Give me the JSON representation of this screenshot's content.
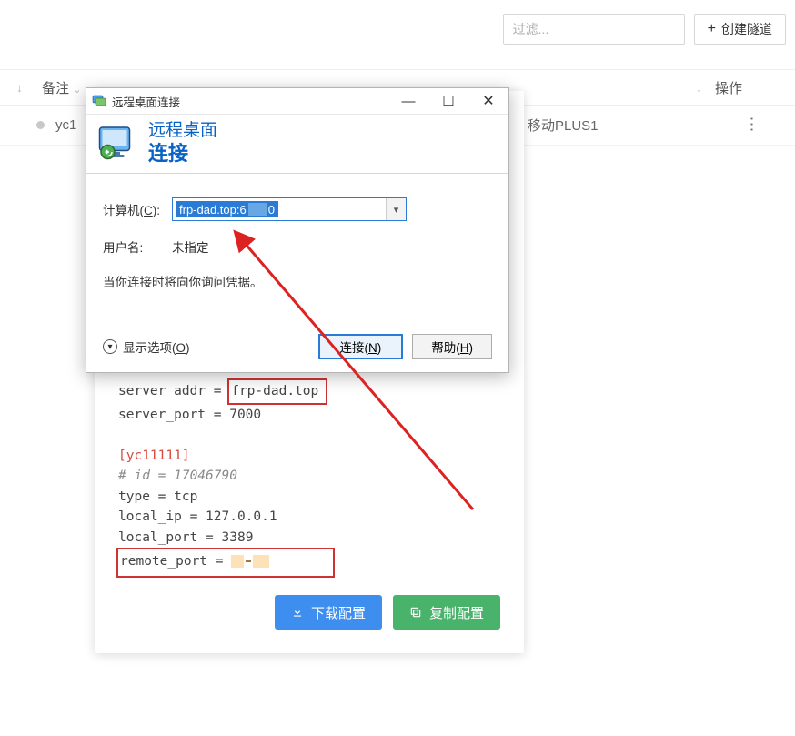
{
  "topbar": {
    "filter_placeholder": "过滤...",
    "create_label": "创建隧道"
  },
  "table": {
    "header_remark": "备注",
    "header_actions": "操作",
    "row": {
      "name": "yc1",
      "node": "移动PLUS1"
    }
  },
  "rdc": {
    "window_title": "远程桌面连接",
    "header_title1": "远程桌面",
    "header_title2": "连接",
    "label_computer": "计算机",
    "label_computer_mnemonic": "C",
    "computer_value_prefix": "frp-dad.top:6",
    "computer_value_suffix": "0",
    "label_user": "用户名:",
    "user_value": "未指定",
    "hint": "当你连接时将向你询问凭据。",
    "show_options": "显示选项",
    "show_options_mnemonic": "O",
    "connect_label": "连接",
    "connect_mnemonic": "N",
    "help_label": "帮助",
    "help_mnemonic": "H"
  },
  "config": {
    "lines": [
      {
        "key": "server_addr",
        "value": "frp-dad.top",
        "boxed": true
      },
      {
        "key": "server_port",
        "value": "7000"
      }
    ],
    "section": "[yc11111]",
    "comment": "# id = 17046790",
    "body": [
      {
        "key": "type",
        "value": "tcp"
      },
      {
        "key": "local_ip",
        "value": "127.0.0.1"
      },
      {
        "key": "local_port",
        "value": "3389"
      }
    ],
    "remote_port_key": "remote_port"
  },
  "card_buttons": {
    "download": "下载配置",
    "copy": "复制配置"
  }
}
